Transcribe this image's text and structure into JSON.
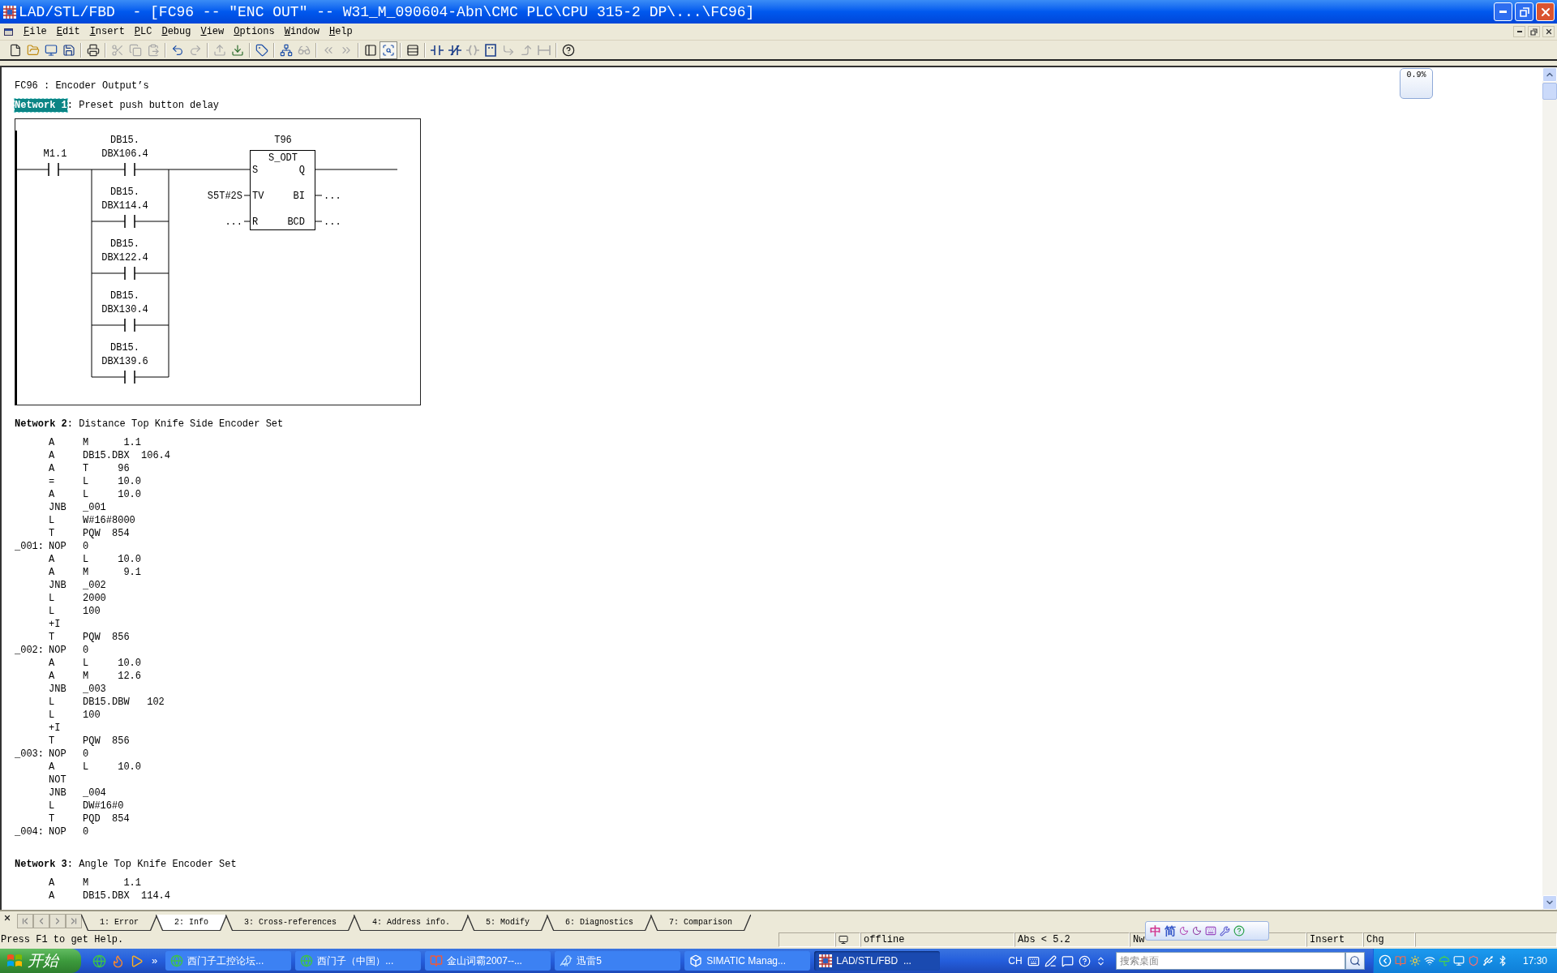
{
  "window": {
    "title": "LAD/STL/FBD  - [FC96 -- \"ENC OUT\" -- W31_M_090604-Abn\\CMC PLC\\CPU 315-2 DP\\...\\FC96]"
  },
  "menu": [
    "File",
    "Edit",
    "Insert",
    "PLC",
    "Debug",
    "View",
    "Options",
    "Window",
    "Help"
  ],
  "toolbar": [
    [
      {
        "kind": "new",
        "disabled": false,
        "pressed": false
      },
      {
        "kind": "open",
        "disabled": false,
        "pressed": false
      },
      {
        "kind": "nodes",
        "disabled": false,
        "pressed": false
      },
      {
        "kind": "save",
        "disabled": false,
        "pressed": false
      }
    ],
    [
      {
        "kind": "print",
        "disabled": false,
        "pressed": false
      }
    ],
    [
      {
        "kind": "cut",
        "disabled": true,
        "pressed": false
      },
      {
        "kind": "copy",
        "disabled": true,
        "pressed": false
      },
      {
        "kind": "paste",
        "disabled": true,
        "pressed": false
      }
    ],
    [
      {
        "kind": "undo",
        "disabled": false,
        "pressed": false
      },
      {
        "kind": "redo",
        "disabled": true,
        "pressed": false
      }
    ],
    [
      {
        "kind": "upload",
        "disabled": true,
        "pressed": false
      },
      {
        "kind": "download",
        "disabled": false,
        "pressed": false
      }
    ],
    [
      {
        "kind": "tag",
        "disabled": false,
        "pressed": false
      }
    ],
    [
      {
        "kind": "online",
        "disabled": false,
        "pressed": false
      },
      {
        "kind": "monitor",
        "disabled": true,
        "pressed": false
      }
    ],
    [
      {
        "kind": "previous",
        "disabled": true,
        "pressed": false
      },
      {
        "kind": "next",
        "disabled": true,
        "pressed": false
      }
    ],
    [
      {
        "kind": "overview",
        "disabled": false,
        "pressed": false
      },
      {
        "kind": "zoom",
        "disabled": false,
        "pressed": true
      }
    ],
    [
      {
        "kind": "layout",
        "disabled": false,
        "pressed": false
      }
    ],
    [
      {
        "kind": "contact",
        "disabled": false,
        "pressed": false
      },
      {
        "kind": "nc_contact",
        "disabled": false,
        "pressed": false
      },
      {
        "kind": "coil",
        "disabled": true,
        "pressed": false
      },
      {
        "kind": "box",
        "disabled": false,
        "pressed": false
      },
      {
        "kind": "branch_open",
        "disabled": true,
        "pressed": false
      },
      {
        "kind": "branch_close",
        "disabled": true,
        "pressed": false
      },
      {
        "kind": "connect",
        "disabled": true,
        "pressed": false
      }
    ],
    [
      {
        "kind": "help",
        "disabled": false,
        "pressed": false
      }
    ]
  ],
  "editor": {
    "block_title": "FC96 : Encoder Output’s",
    "networks": [
      {
        "label": "Network 1",
        "selected": true,
        "title": ": Preset push button delay",
        "kind": "ladder",
        "ladder": {
          "series_contacts": [
            {
              "label": "M1.1"
            }
          ],
          "parallel_contacts": [
            {
              "label_lines": [
                "DB15.",
                "DBX106.4"
              ]
            },
            {
              "label_lines": [
                "DB15.",
                "DBX114.4"
              ]
            },
            {
              "label_lines": [
                "DB15.",
                "DBX122.4"
              ]
            },
            {
              "label_lines": [
                "DB15.",
                "DBX130.4"
              ]
            },
            {
              "label_lines": [
                "DB15.",
                "DBX139.6"
              ]
            }
          ],
          "timer": {
            "name": "T96",
            "type": "S_ODT",
            "inputs": [
              {
                "pin": "S"
              },
              {
                "pin": "TV",
                "value": "S5T#2S"
              },
              {
                "pin": "R",
                "value": "..."
              }
            ],
            "outputs": [
              {
                "pin": "Q"
              },
              {
                "pin": "BI",
                "value": "..."
              },
              {
                "pin": "BCD",
                "value": "..."
              }
            ]
          }
        }
      },
      {
        "label": "Network 2",
        "selected": false,
        "title": ": Distance Top Knife Side Encoder Set",
        "kind": "stl",
        "lines": [
          {
            "op": "A",
            "operand": "M      1.1"
          },
          {
            "op": "A",
            "operand": "DB15.DBX  106.4"
          },
          {
            "op": "A",
            "operand": "T     96"
          },
          {
            "op": "=",
            "operand": "L     10.0"
          },
          {
            "op": "A",
            "operand": "L     10.0"
          },
          {
            "op": "JNB",
            "operand": "_001"
          },
          {
            "op": "L",
            "operand": "W#16#8000"
          },
          {
            "op": "T",
            "operand": "PQW  854"
          },
          {
            "label": "_001:",
            "op": "NOP",
            "operand": "0"
          },
          {
            "op": "A",
            "operand": "L     10.0"
          },
          {
            "op": "A",
            "operand": "M      9.1"
          },
          {
            "op": "JNB",
            "operand": "_002"
          },
          {
            "op": "L",
            "operand": "2000"
          },
          {
            "op": "L",
            "operand": "100"
          },
          {
            "op": "+I"
          },
          {
            "op": "T",
            "operand": "PQW  856"
          },
          {
            "label": "_002:",
            "op": "NOP",
            "operand": "0"
          },
          {
            "op": "A",
            "operand": "L     10.0"
          },
          {
            "op": "A",
            "operand": "M     12.6"
          },
          {
            "op": "JNB",
            "operand": "_003"
          },
          {
            "op": "L",
            "operand": "DB15.DBW   102"
          },
          {
            "op": "L",
            "operand": "100"
          },
          {
            "op": "+I"
          },
          {
            "op": "T",
            "operand": "PQW  856"
          },
          {
            "label": "_003:",
            "op": "NOP",
            "operand": "0"
          },
          {
            "op": "A",
            "operand": "L     10.0"
          },
          {
            "op": "NOT"
          },
          {
            "op": "JNB",
            "operand": "_004"
          },
          {
            "op": "L",
            "operand": "DW#16#0"
          },
          {
            "op": "T",
            "operand": "PQD  854"
          },
          {
            "label": "_004:",
            "op": "NOP",
            "operand": "0"
          }
        ]
      },
      {
        "label": "Network 3",
        "selected": false,
        "title": ": Angle Top Knife Encoder Set",
        "kind": "stl",
        "lines": [
          {
            "op": "A",
            "operand": "M      1.1"
          },
          {
            "op": "A",
            "operand": "DB15.DBX  114.4"
          }
        ]
      }
    ]
  },
  "load_meter": {
    "reading": "0.9%"
  },
  "detail_tabs": [
    {
      "label": "1: Error",
      "selected": false
    },
    {
      "label": "2: Info",
      "selected": true
    },
    {
      "label": "3: Cross-references",
      "selected": false
    },
    {
      "label": "4: Address info.",
      "selected": false
    },
    {
      "label": "5: Modify",
      "selected": false
    },
    {
      "label": "6: Diagnostics",
      "selected": false
    },
    {
      "label": "7: Comparison",
      "selected": false
    }
  ],
  "status_bar": {
    "message": "Press F1 to get Help.",
    "panes": [
      {
        "kind": "blank"
      },
      {
        "kind": "connection"
      },
      {
        "kind": "text",
        "text": "offline"
      },
      {
        "kind": "text",
        "text": "Abs < 5.2"
      },
      {
        "kind": "text",
        "text": "Nw"
      },
      {
        "kind": "text",
        "text": "Insert"
      },
      {
        "kind": "text",
        "text": "Chg"
      },
      {
        "kind": "blank"
      }
    ]
  },
  "ime_bar": {
    "mode": "中",
    "script": "简"
  },
  "taskbar": {
    "start_label": "开始",
    "quick_launch_more": "»",
    "tasks": [
      {
        "kind": "browser",
        "label": "西门子工控论坛...",
        "selected": false
      },
      {
        "kind": "browser",
        "label": "西门子（中国）...",
        "selected": false
      },
      {
        "kind": "dictionary",
        "label": "金山词霸2007--...",
        "selected": false
      },
      {
        "kind": "downloader",
        "label": "迅雷5",
        "selected": false
      },
      {
        "kind": "simatic",
        "label": "SIMATIC Manag...",
        "selected": false
      },
      {
        "kind": "editor",
        "label": "LAD/STL/FBD  ...",
        "selected": true
      }
    ],
    "language": "CH",
    "search": {
      "placeholder": "搜索桌面"
    },
    "clock": "17:30"
  }
}
